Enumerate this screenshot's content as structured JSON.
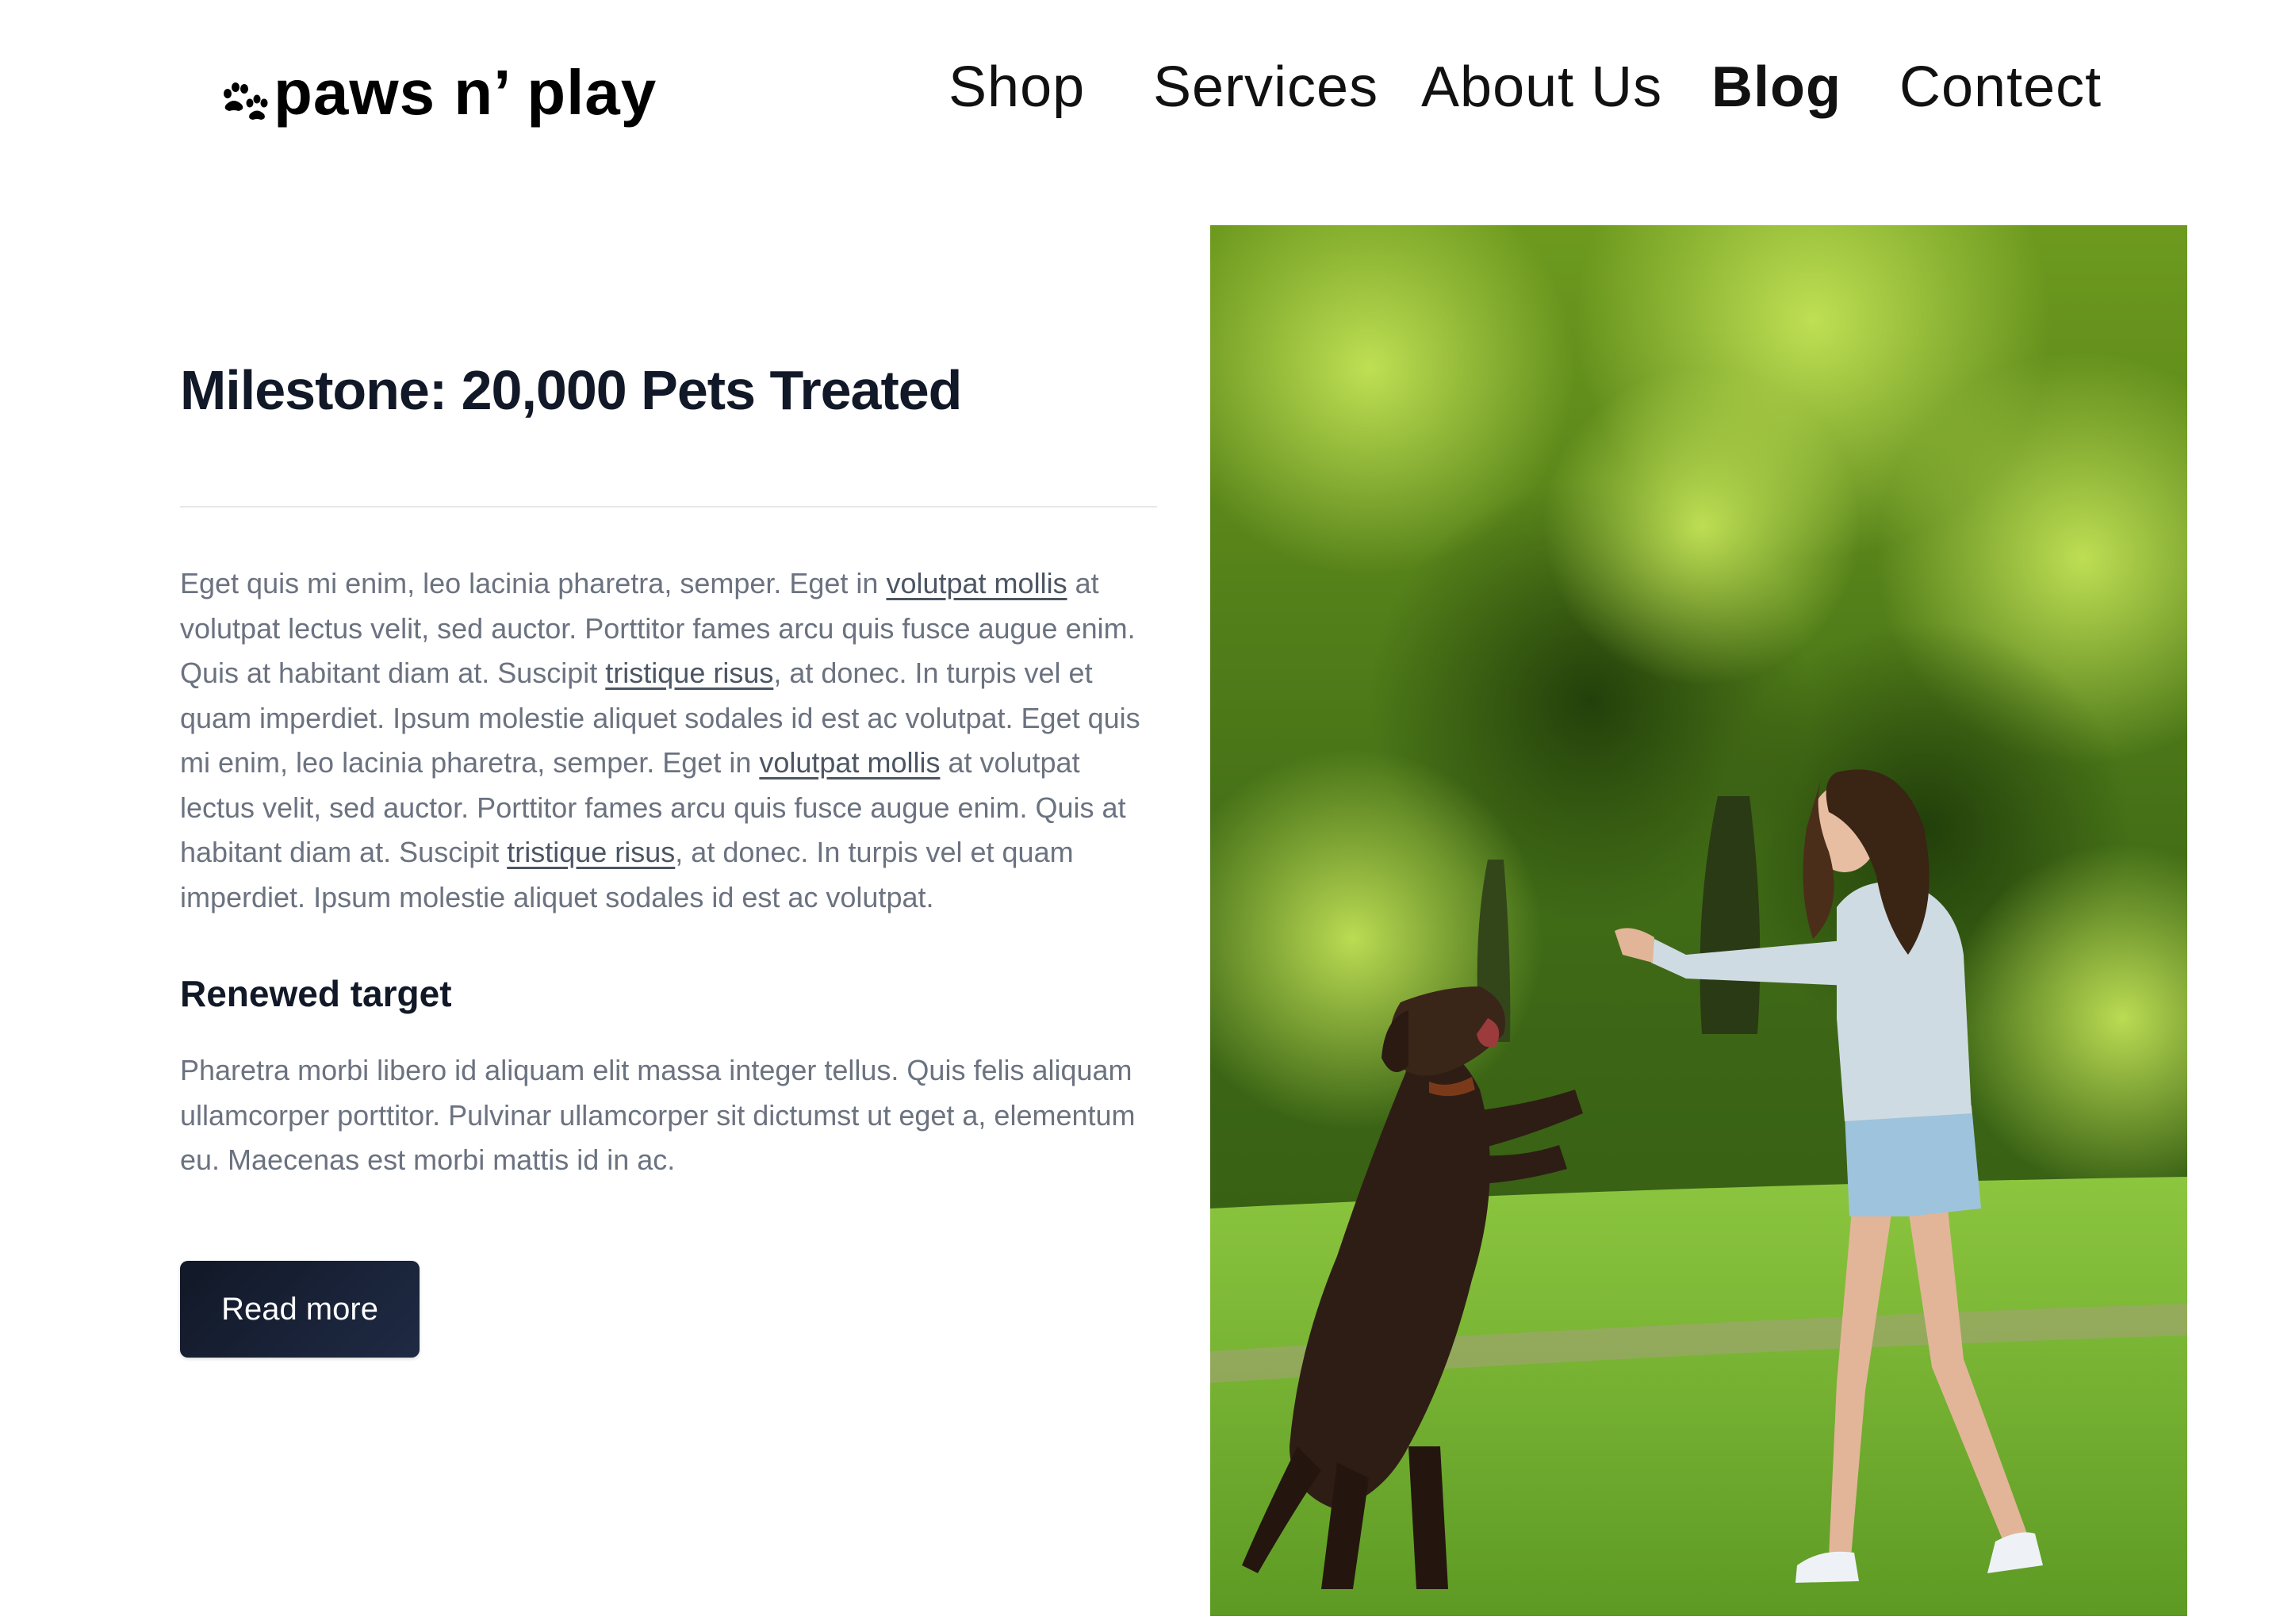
{
  "brand": {
    "name": "paws n’ play",
    "icon": "paw-print-icon"
  },
  "nav": {
    "items": [
      {
        "label": "Shop",
        "active": false
      },
      {
        "label": "Services",
        "active": false
      },
      {
        "label": "About Us",
        "active": false
      },
      {
        "label": "Blog",
        "active": true
      },
      {
        "label": "Contect",
        "active": false
      }
    ]
  },
  "article": {
    "title": "Milestone: 20,000 Pets Treated",
    "body": {
      "s1": "Eget quis mi enim, leo lacinia pharetra, semper. Eget in ",
      "link1": "volutpat mollis",
      "s2": " at volutpat lectus velit, sed auctor. Porttitor fames arcu quis fusce augue enim. Quis at habitant diam at. Suscipit ",
      "link2": "tristique risus",
      "s3": ", at donec. In turpis vel et quam imperdiet. Ipsum molestie aliquet sodales id est ac volutpat. Eget quis mi enim, leo lacinia pharetra, semper. Eget in ",
      "link3": "volutpat mollis",
      "s4": " at volutpat lectus velit, sed auctor. Porttitor fames arcu quis fusce augue enim. Quis at habitant diam at. Suscipit ",
      "link4": "tristique risus",
      "s5": ", at donec. In turpis vel et quam imperdiet. Ipsum molestie aliquet sodales id est ac volutpat."
    },
    "subheading": "Renewed target",
    "subtext": "Pharetra morbi libero id aliquam elit massa integer tellus. Quis felis aliquam ullamcorper porttitor. Pulvinar ullamcorper sit dictumst ut eget a, elementum eu. Maecenas est morbi mattis id in ac.",
    "button_label": "Read more"
  },
  "photo": {
    "subject": "woman-playing-with-dog-in-park"
  },
  "colors": {
    "text_dark": "#111827",
    "text_muted": "#6b7280",
    "button_bg": "#111827",
    "divider": "#e5e7eb"
  }
}
